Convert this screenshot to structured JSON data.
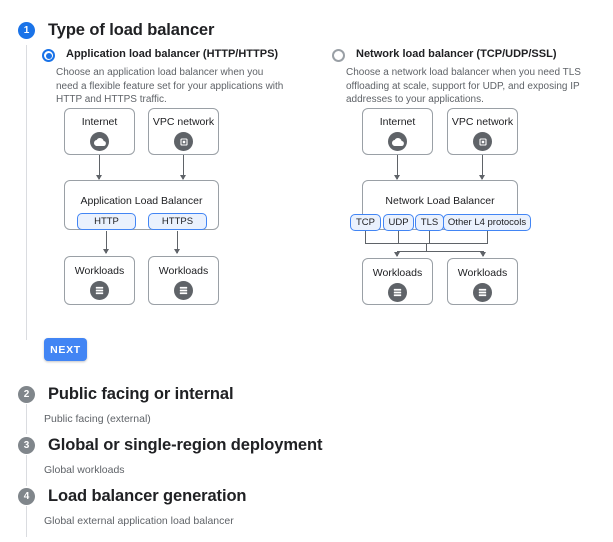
{
  "colors": {
    "accent": "#1a73e8",
    "button": "#4285f4",
    "chip_border": "#4285f4",
    "chip_fill": "#eaf1fd",
    "step_done": "#80868b",
    "icon_circle": "#5f6368",
    "node_border": "#9aa0a6",
    "text": "#202124",
    "muted": "#5f6368"
  },
  "steps": [
    {
      "num": "1",
      "title": "Type of load balancer",
      "state": "active",
      "summary": ""
    },
    {
      "num": "2",
      "title": "Public facing or internal",
      "state": "done",
      "summary": "Public facing (external)"
    },
    {
      "num": "3",
      "title": "Global or single-region deployment",
      "state": "done",
      "summary": "Global workloads"
    },
    {
      "num": "4",
      "title": "Load balancer generation",
      "state": "done",
      "summary": "Global external application load balancer"
    }
  ],
  "options": [
    {
      "id": "application",
      "label": "Application load balancer (HTTP/HTTPS)",
      "selected": true,
      "description": "Choose an application load balancer when you need a flexible feature set for your applications with HTTP and HTTPS traffic.",
      "diagram": {
        "top_nodes": [
          {
            "label": "Internet",
            "icon": "cloud-icon"
          },
          {
            "label": "VPC network",
            "icon": "vpc-network-icon"
          }
        ],
        "balancer": "Application Load Balancer",
        "protocols": [
          "HTTP",
          "HTTPS"
        ],
        "bottom_nodes": [
          {
            "label": "Workloads",
            "icon": "workloads-icon"
          },
          {
            "label": "Workloads",
            "icon": "workloads-icon"
          }
        ]
      }
    },
    {
      "id": "network",
      "label": "Network load balancer (TCP/UDP/SSL)",
      "selected": false,
      "description": "Choose a network load balancer when you need TLS offloading at scale, support for UDP, and exposing IP addresses to your applications.",
      "diagram": {
        "top_nodes": [
          {
            "label": "Internet",
            "icon": "cloud-icon"
          },
          {
            "label": "VPC network",
            "icon": "vpc-network-icon"
          }
        ],
        "balancer": "Network Load Balancer",
        "protocols": [
          "TCP",
          "UDP",
          "TLS",
          "Other L4 protocols"
        ],
        "bottom_nodes": [
          {
            "label": "Workloads",
            "icon": "workloads-icon"
          },
          {
            "label": "Workloads",
            "icon": "workloads-icon"
          }
        ]
      }
    }
  ],
  "actions": {
    "next_label": "NEXT"
  }
}
